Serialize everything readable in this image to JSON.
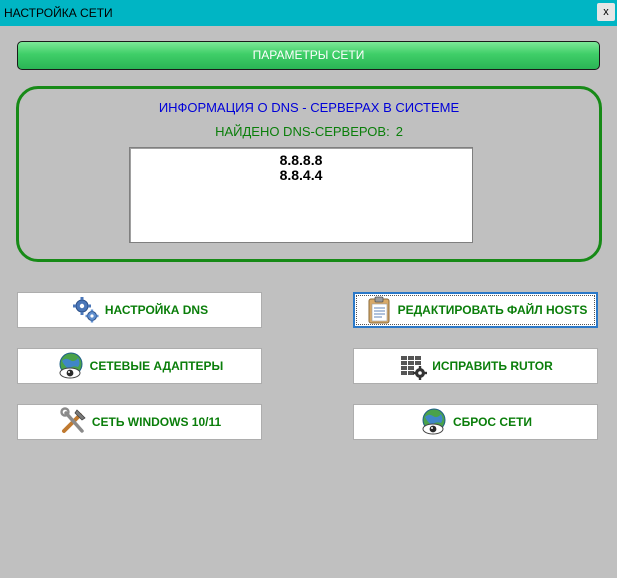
{
  "window": {
    "title": "НАСТРОЙКА СЕТИ",
    "close_label": "x"
  },
  "header": {
    "params_label": "ПАРАМЕТРЫ СЕТИ"
  },
  "dns": {
    "title": "ИНФОРМАЦИЯ О DNS - СЕРВЕРАХ В СИСТЕМЕ",
    "found_label": "НАЙДЕНО DNS-СЕРВЕРОВ:",
    "found_count": "2",
    "servers": [
      "8.8.8.8",
      "8.8.4.4"
    ]
  },
  "buttons": {
    "dns_settings": {
      "label": "НАСТРОЙКА DNS",
      "icon": "gears-icon"
    },
    "edit_hosts": {
      "label": "РЕДАКТИРОВАТЬ ФАЙЛ HOSTS",
      "icon": "clipboard-icon"
    },
    "network_adapters": {
      "label": "СЕТЕВЫЕ АДАПТЕРЫ",
      "icon": "globe-eye-icon"
    },
    "fix_rutor": {
      "label": "ИСПРАВИТЬ RUTOR",
      "icon": "table-gear-icon"
    },
    "windows_network": {
      "label": "СЕТЬ WINDOWS 10/11",
      "icon": "tools-icon"
    },
    "reset_network": {
      "label": "СБРОС СЕТИ",
      "icon": "globe-eye-icon"
    }
  },
  "colors": {
    "titlebar": "#00b5c4",
    "accent_green": "#0a7e0a",
    "dns_title_blue": "#0000d8",
    "panel_border": "#178a17"
  }
}
